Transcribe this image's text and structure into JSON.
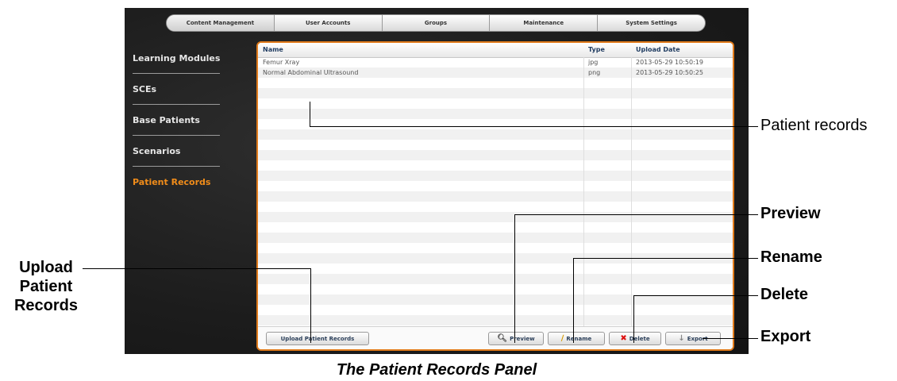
{
  "tabs": [
    "Content Management",
    "User Accounts",
    "Groups",
    "Maintenance",
    "System Settings"
  ],
  "sidebar": {
    "items": [
      {
        "label": "Learning Modules"
      },
      {
        "label": "SCEs"
      },
      {
        "label": "Base Patients"
      },
      {
        "label": "Scenarios"
      },
      {
        "label": "Patient Records"
      }
    ],
    "active_index": 4
  },
  "table": {
    "columns": [
      "Name",
      "Type",
      "Upload Date"
    ],
    "rows": [
      {
        "name": "Femur Xray",
        "type": "jpg",
        "date": "2013-05-29 10:50:19"
      },
      {
        "name": "Normal Abdominal Ultrasound",
        "type": "png",
        "date": "2013-05-29 10:50:25"
      }
    ]
  },
  "toolbar": {
    "upload_label": "Upload Patient Records",
    "preview_label": "Preview",
    "rename_label": "Rename",
    "delete_label": "Delete",
    "export_label": "Export"
  },
  "icons": {
    "preview": "magnifier-icon",
    "rename": "pencil-icon",
    "delete": "red-x-icon",
    "export": "down-arrow-icon"
  },
  "callouts": {
    "patient_records": "Patient records",
    "preview": "Preview",
    "rename": "Rename",
    "delete": "Delete",
    "export": "Export",
    "upload": "Upload Patient Records"
  },
  "caption": "The Patient Records Panel",
  "colors": {
    "accent_orange": "#e07a1a",
    "active_sidebar": "#f08c1a",
    "header_text": "#1e3a5f"
  }
}
